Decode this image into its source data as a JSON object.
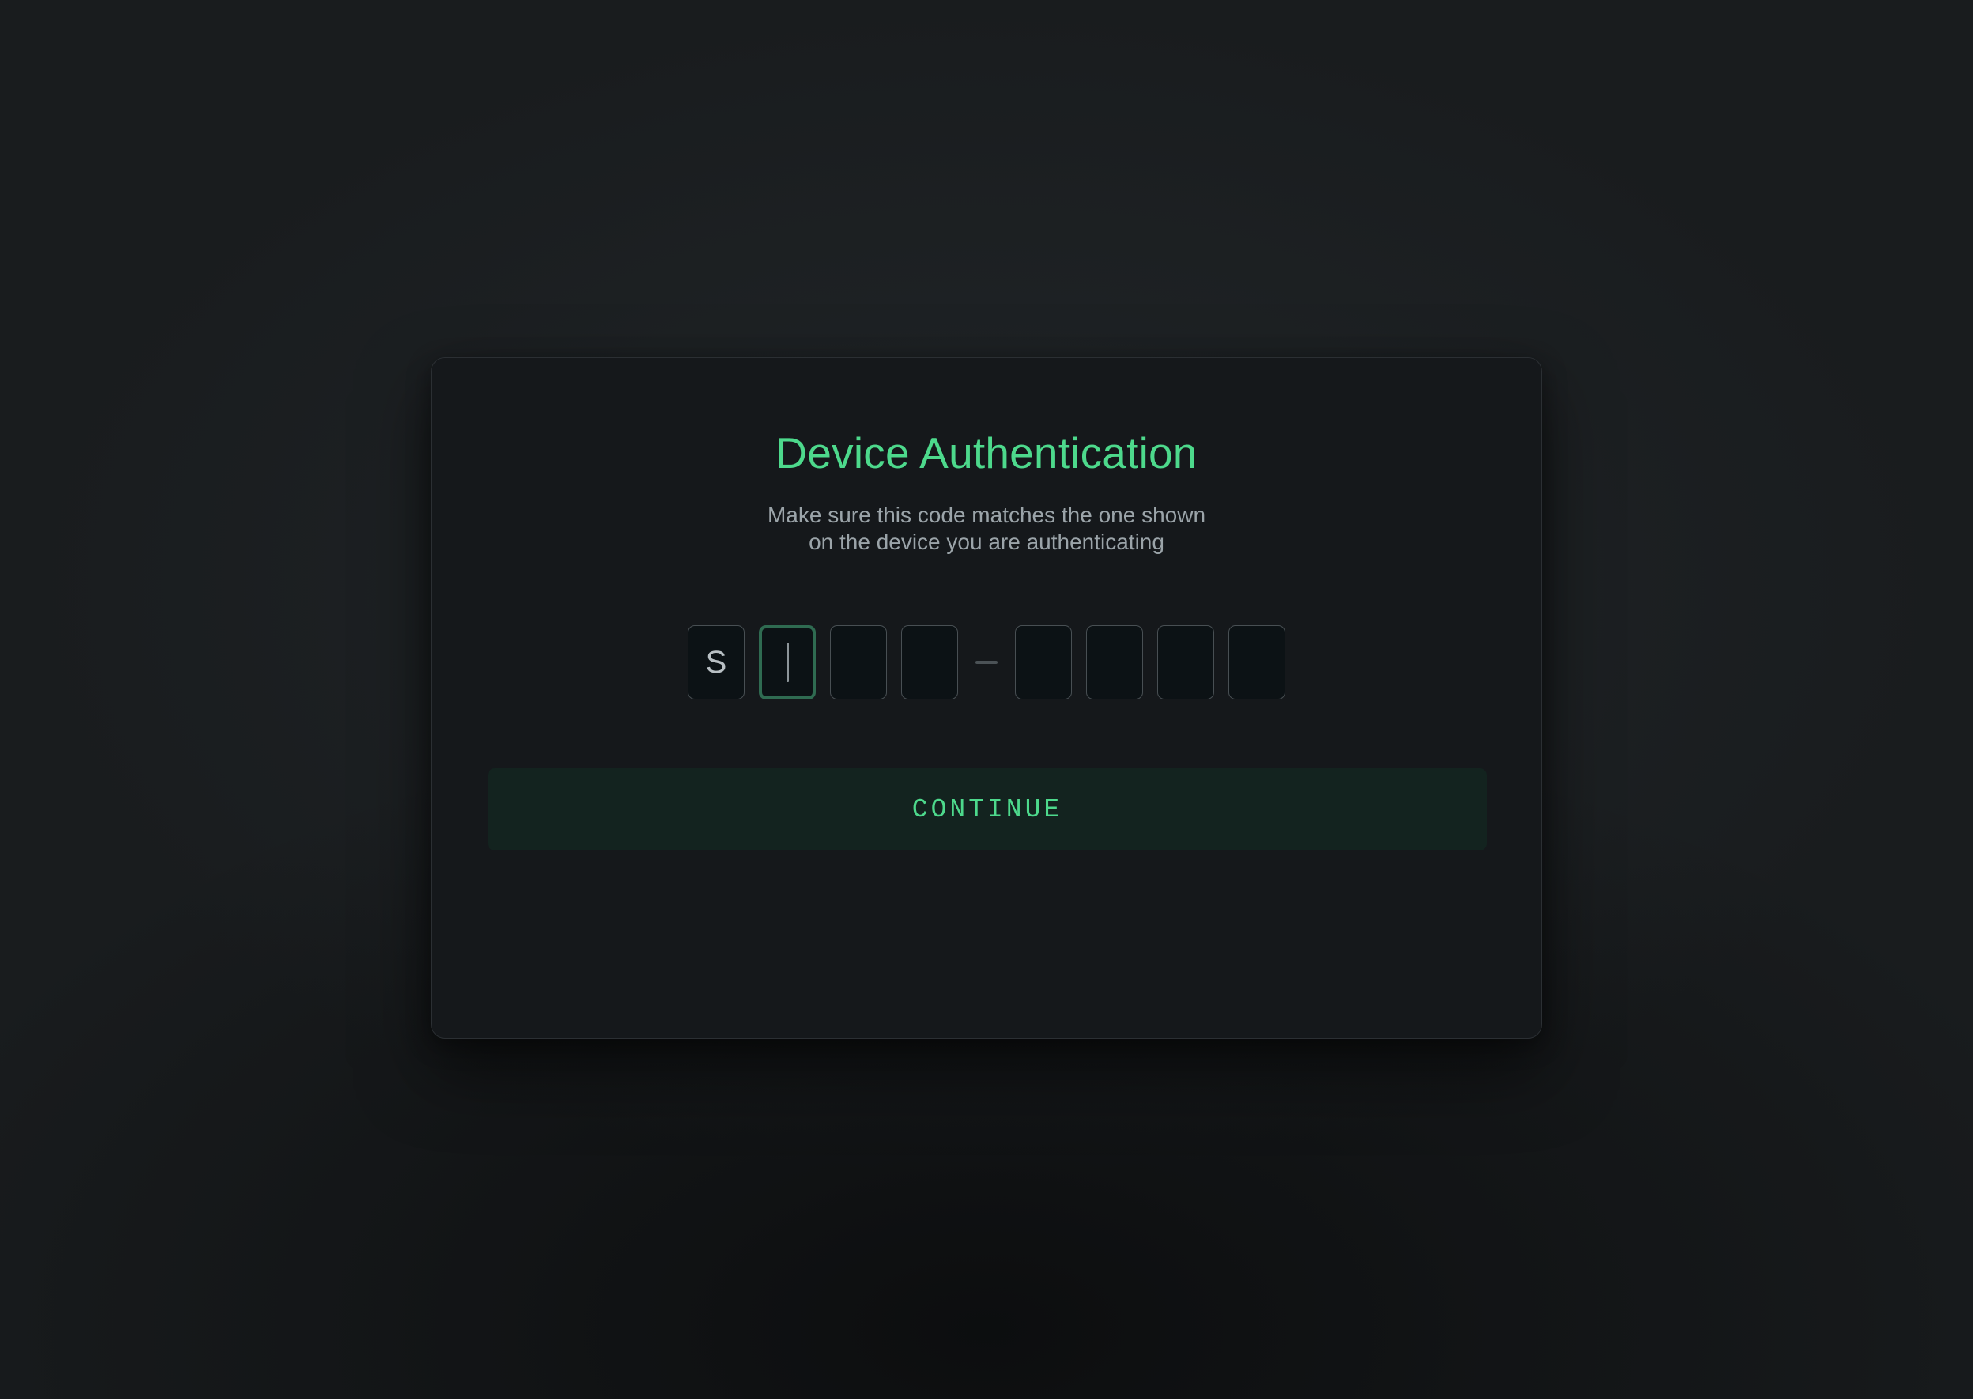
{
  "page": {
    "background_color": "#191c1e"
  },
  "dialog": {
    "title": "Device Authentication",
    "subtitle_line_1": "Make sure this code matches the one shown",
    "subtitle_line_2": "on the device you are authenticating",
    "background_color": "#15181b",
    "border_color": "#2b2f33",
    "accent_color": "#4dd98c"
  },
  "code_entry": {
    "separator": "—",
    "caret_visible": true,
    "focused_index": 1,
    "boxes": [
      {
        "value": "S",
        "focused": false
      },
      {
        "value": "",
        "focused": true
      },
      {
        "value": "",
        "focused": false
      },
      {
        "value": "",
        "focused": false
      },
      {
        "value": "",
        "focused": false
      },
      {
        "value": "",
        "focused": false
      },
      {
        "value": "",
        "focused": false
      },
      {
        "value": "",
        "focused": false
      }
    ],
    "box_border_color": "#484f53",
    "box_fill_color": "#0c1215",
    "focus_border_color": "#2f6b51",
    "caret_color": "#8d9599"
  },
  "actions": {
    "continue_label": "CONTINUE",
    "continue_background": "#13231f",
    "continue_text_color": "#4dd98c"
  }
}
